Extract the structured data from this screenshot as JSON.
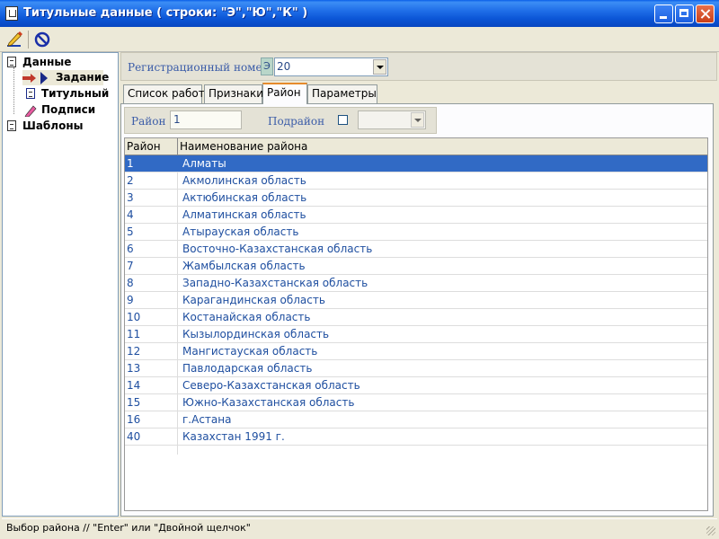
{
  "window": {
    "title": "Титульные данные  ( строки: \"Э\",\"Ю\",\"К\" )"
  },
  "tree": {
    "items": [
      {
        "label": "Данные",
        "icon": "document-icon"
      },
      {
        "label": "Задание",
        "icon": "arrow-right-icon",
        "selected": true
      },
      {
        "label": "Титульный",
        "icon": "title-page-icon"
      },
      {
        "label": "Подписи",
        "icon": "pen-icon"
      },
      {
        "label": "Шаблоны",
        "icon": "document-icon"
      }
    ]
  },
  "registration": {
    "label": "Регистрационный номер",
    "prefix": "Э",
    "value": "20"
  },
  "tabs": [
    {
      "label": "Список работ"
    },
    {
      "label": "Признаки"
    },
    {
      "label": "Район",
      "active": true
    },
    {
      "label": "Параметры"
    }
  ],
  "filter": {
    "district_label": "Район",
    "district_value": "1",
    "subdistrict_label": "Подрайон"
  },
  "grid": {
    "columns": [
      "Район",
      "Наименование района"
    ],
    "rows": [
      [
        "1",
        "Алматы"
      ],
      [
        "2",
        "Акмолинская область"
      ],
      [
        "3",
        "Актюбинская область"
      ],
      [
        "4",
        "Алматинская область"
      ],
      [
        "5",
        "Атырауская область"
      ],
      [
        "6",
        "Восточно-Казахстанская область"
      ],
      [
        "7",
        "Жамбылская область"
      ],
      [
        "8",
        "Западно-Казахстанская область"
      ],
      [
        "9",
        "Карагандинская область"
      ],
      [
        "10",
        "Костанайская область"
      ],
      [
        "11",
        "Кызылординская область"
      ],
      [
        "12",
        "Мангистауская область"
      ],
      [
        "13",
        "Павлодарская область"
      ],
      [
        "14",
        "Северо-Казахстанская область"
      ],
      [
        "15",
        "Южно-Казахстанская область"
      ],
      [
        "16",
        "г.Астана"
      ],
      [
        "40",
        "Казахстан 1991 г."
      ]
    ]
  },
  "status": {
    "text": "Выбор района // \"Enter\" или \"Двойной щелчок\""
  },
  "colors": {
    "titlebar": "#0b55d6",
    "selection": "#316ac5",
    "link_text": "#1f4fa0",
    "label_text": "#3b5ca8"
  }
}
